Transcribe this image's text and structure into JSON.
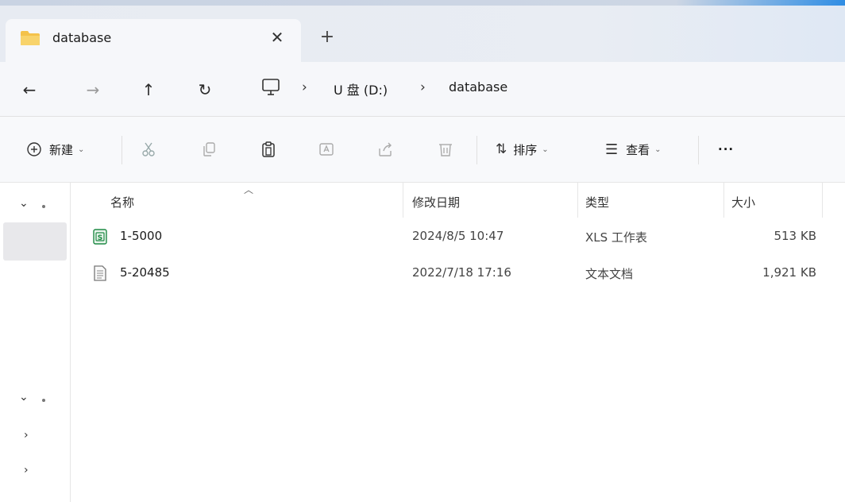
{
  "window": {
    "tab_title": "database",
    "tab_close_glyph": "✕",
    "new_tab_glyph": "+"
  },
  "nav": {
    "back_glyph": "←",
    "forward_glyph": "→",
    "up_glyph": "↑",
    "refresh_glyph": "↻"
  },
  "breadcrumb": {
    "separator": "›",
    "items": [
      "U 盘 (D:)",
      "database"
    ]
  },
  "toolbar": {
    "new_label": "新建",
    "sort_label": "排序",
    "view_label": "查看",
    "more_label": "···"
  },
  "columns": {
    "name": "名称",
    "modified": "修改日期",
    "type": "类型",
    "size": "大小"
  },
  "files": [
    {
      "name": "1-5000",
      "modified": "2024/8/5 10:47",
      "type": "XLS 工作表",
      "size": "513 KB",
      "icon": "spreadsheet-icon"
    },
    {
      "name": "5-20485",
      "modified": "2022/7/18 17:16",
      "type": "文本文档",
      "size": "1,921 KB",
      "icon": "text-file-icon"
    }
  ],
  "colors": {
    "accent": "#2f8de4",
    "folder": "#f4c24a",
    "spreadsheet": "#1f8a45"
  }
}
